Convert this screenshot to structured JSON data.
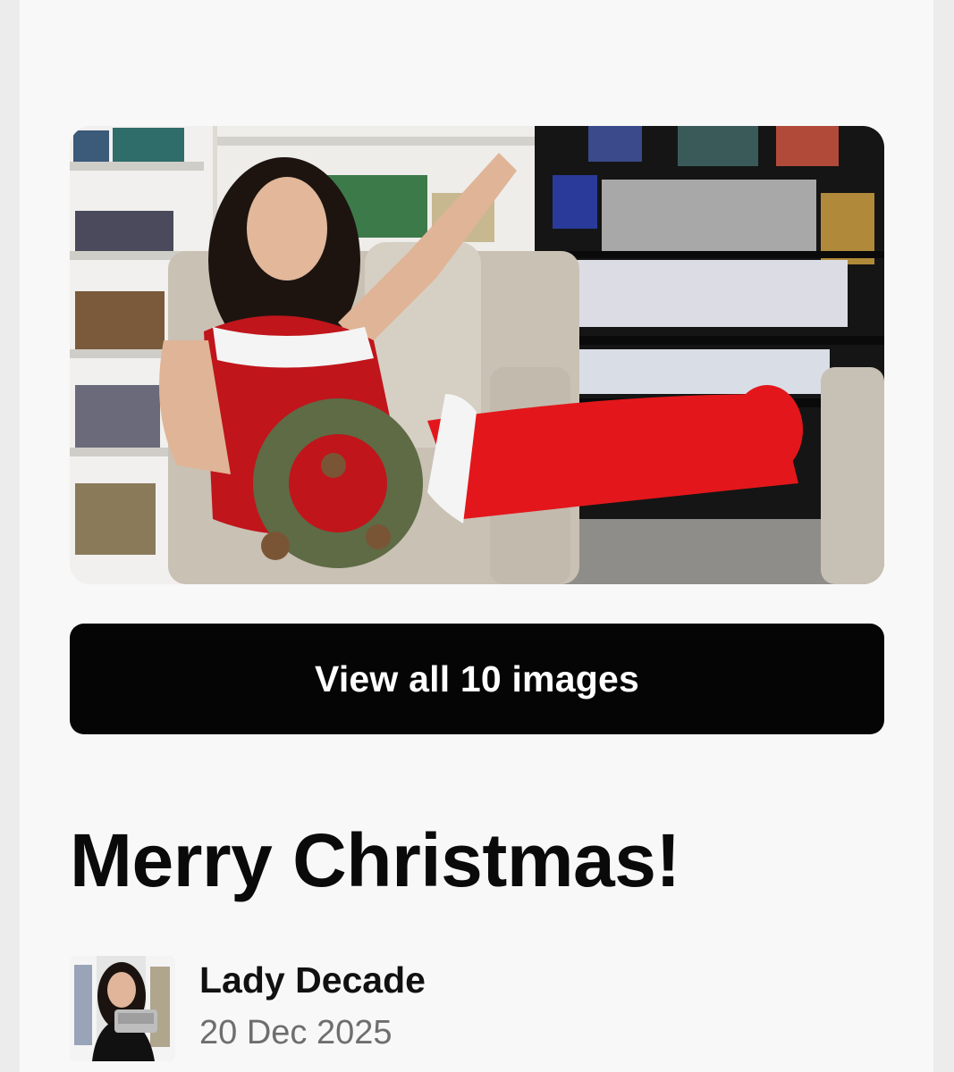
{
  "gallery": {
    "view_all_label": "View all 10 images",
    "hero_image": "christmas-photo"
  },
  "post": {
    "title": "Merry Christmas!"
  },
  "author": {
    "name": "Lady Decade",
    "date": "20 Dec 2025",
    "avatar_image": "author-avatar"
  },
  "colors": {
    "page_background": "#f8f8f8",
    "button_background": "#050505",
    "button_text": "#ffffff",
    "title_text": "#0a0a0a",
    "date_text": "#6e6e6e"
  }
}
